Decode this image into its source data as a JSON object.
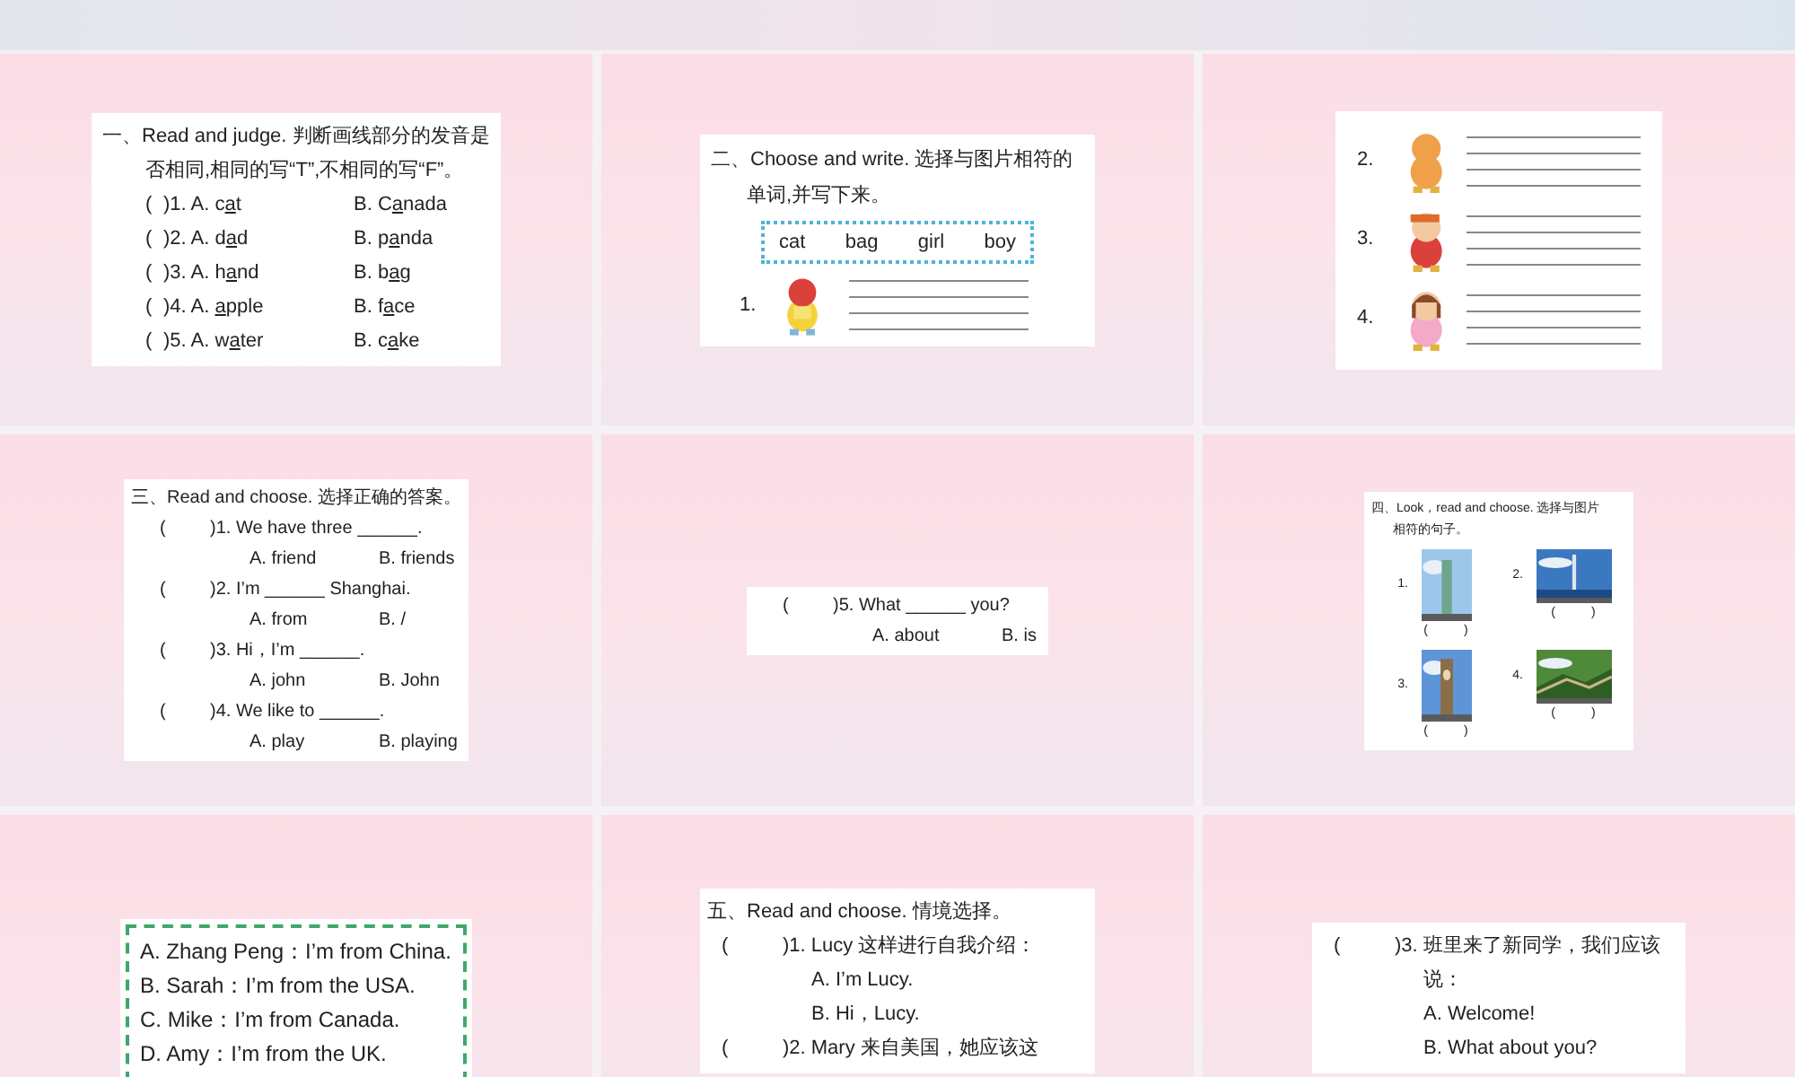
{
  "slides": [
    {
      "kind": "judge",
      "heading": [
        "一、Read and judge. 判断画线部分的发音是",
        "否相同,相同的写“T”,不相同的写“F”。"
      ],
      "items": [
        {
          "paren": "(",
          "number": ")1.",
          "a_label": "A.",
          "a": {
            "pre": "c",
            "mark": "a",
            "post": "t"
          },
          "b_label": "B.",
          "b": {
            "pre": "C",
            "mark": "a",
            "post": "nada"
          }
        },
        {
          "paren": "(",
          "number": ")2.",
          "a_label": "A.",
          "a": {
            "pre": "d",
            "mark": "a",
            "post": "d"
          },
          "b_label": "B.",
          "b": {
            "pre": "p",
            "mark": "a",
            "post": "nda"
          }
        },
        {
          "paren": "(",
          "number": ")3.",
          "a_label": "A.",
          "a": {
            "pre": "h",
            "mark": "a",
            "post": "nd"
          },
          "b_label": "B.",
          "b": {
            "pre": "b",
            "mark": "a",
            "post": "g"
          }
        },
        {
          "paren": "(",
          "number": ")4.",
          "a_label": "A.",
          "a": {
            "mark": "a",
            "post": "pple"
          },
          "b_label": "B.",
          "b": {
            "pre": "f",
            "mark": "a",
            "post": "ce"
          }
        },
        {
          "paren": "(",
          "number": ")5.",
          "a_label": "A.",
          "a": {
            "pre": "w",
            "mark": "a",
            "post": "ter"
          },
          "b_label": "B.",
          "b": {
            "pre": "c",
            "mark": "a",
            "post": "ke"
          }
        }
      ]
    },
    {
      "kind": "words",
      "heading": [
        "二、Choose and write. 选择与图片相符的",
        "单词,并写下来。"
      ],
      "words": [
        "cat",
        "bag",
        "girl",
        "boy"
      ],
      "items": [
        {
          "number": "1."
        }
      ]
    },
    {
      "kind": "write",
      "items": [
        {
          "number": "2."
        },
        {
          "number": "3."
        },
        {
          "number": "4."
        }
      ]
    },
    {
      "kind": "choose",
      "heading": [
        "三、Read and choose. 选择正确的答案。"
      ],
      "items": [
        {
          "paren": "(",
          "question": ")1. We have three ______.",
          "a": "A. friend",
          "b": "B. friends"
        },
        {
          "paren": "(",
          "question": ")2. I’m ______ Shanghai.",
          "a": "A. from",
          "b": "B. /"
        },
        {
          "paren": "(",
          "question": ")3. Hi，I’m ______.",
          "a": "A. john",
          "b": "B. John"
        },
        {
          "paren": "(",
          "question": ")4. We like to ______.",
          "a": "A. play",
          "b": "B. playing"
        }
      ]
    },
    {
      "kind": "choose",
      "items": [
        {
          "paren": "(",
          "question": ")5. What ______ you?",
          "a": "A. about",
          "b": "B. is"
        }
      ]
    },
    {
      "kind": "look",
      "heading": [
        "四、Look，read and choose. 选择与图片",
        "相符的句子。"
      ],
      "items": [
        {
          "number": "1.",
          "open": "(",
          "close": ")"
        },
        {
          "number": "2.",
          "open": "(",
          "close": ")"
        },
        {
          "number": "3.",
          "open": "(",
          "close": ")"
        },
        {
          "number": "4.",
          "open": "(",
          "close": ")"
        }
      ]
    },
    {
      "kind": "options",
      "items": [
        "A. Zhang Peng：I’m from China.",
        "B. Sarah：I’m from the USA.",
        "C. Mike：I’m from Canada.",
        "D. Amy：I’m from the UK."
      ]
    },
    {
      "kind": "scenario",
      "lines": [
        {
          "kind": "heading",
          "text": "五、Read and choose. 情境选择。"
        },
        {
          "kind": "question",
          "paren": "(",
          "text": ")1. Lucy 这样进行自我介绍："
        },
        {
          "kind": "option",
          "text": "A. I’m Lucy."
        },
        {
          "kind": "option",
          "text": "B. Hi，Lucy."
        },
        {
          "kind": "question",
          "paren": "(",
          "text": ")2. Mary 来自美国，她应该这"
        }
      ]
    },
    {
      "kind": "scenario",
      "lines": [
        {
          "kind": "question",
          "paren": "(",
          "text": ")3. 班里来了新同学，我们应该"
        },
        {
          "kind": "option",
          "text": "说："
        },
        {
          "kind": "option",
          "text": "A. Welcome!"
        },
        {
          "kind": "option",
          "text": "B. What about you?"
        }
      ]
    }
  ]
}
